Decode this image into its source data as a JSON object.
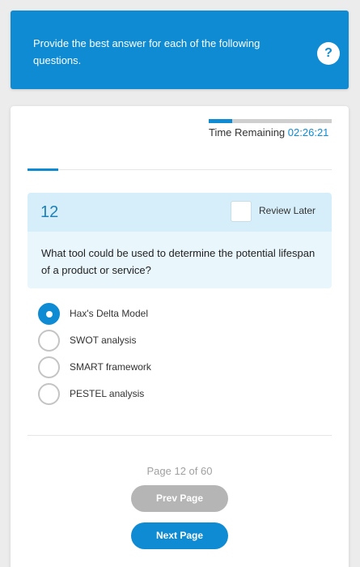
{
  "instructions": {
    "text": "Provide the best answer for each of the following questions.",
    "help_icon": "?"
  },
  "timer": {
    "label": "Time Remaining",
    "value": "02:26:21",
    "progress_fraction": 0.19
  },
  "question": {
    "number": "12",
    "review_label": "Review Later",
    "review_checked": false,
    "text": "What tool could be used to determine the potential lifespan of a product or service?",
    "options": [
      {
        "label": "Hax's Delta Model",
        "selected": true
      },
      {
        "label": "SWOT analysis",
        "selected": false
      },
      {
        "label": "SMART framework",
        "selected": false
      },
      {
        "label": "PESTEL analysis",
        "selected": false
      }
    ]
  },
  "pagination": {
    "indicator": "Page 12 of 60",
    "prev_label": "Prev Page",
    "next_label": "Next Page"
  },
  "colors": {
    "accent": "#0e8bd3",
    "question_header_bg": "#d6eef9",
    "question_body_bg": "#e9f6fc",
    "prev_button_bg": "#b5b5b5"
  }
}
